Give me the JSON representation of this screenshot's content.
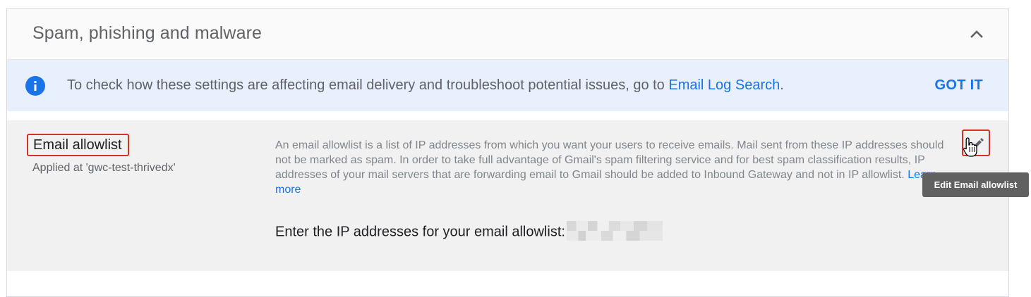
{
  "section": {
    "title": "Spam, phishing and malware",
    "collapse_icon": "chevron-up-icon"
  },
  "banner": {
    "icon": "info-icon",
    "text": "To check how these settings are affecting email delivery and troubleshoot potential issues, go to ",
    "link": "Email Log Search",
    "text_end": ".",
    "action": "GOT IT"
  },
  "setting": {
    "name": "Email allowlist",
    "applied_at": "Applied at 'gwc-test-thrivedx'",
    "description": "An email allowlist is a list of IP addresses from which you want your users to receive emails. Mail sent from these IP addresses should not be marked as spam. In order to take full advantage of Gmail's spam filtering service and for best spam classification results, IP addresses of your mail servers that are forwarding email to Gmail should be added to Inbound Gateway and not in IP allowlist. ",
    "learn_more": "Learn more",
    "ip_label": "Enter the IP addresses for your email allowlist:",
    "edit_icon": "pencil-icon",
    "tooltip": "Edit Email allowlist"
  },
  "colors": {
    "accent": "#1a73e8",
    "highlight_border": "#d93025",
    "banner_bg": "#e8f0fe",
    "row_bg": "#f1f1f1",
    "tooltip_bg": "#616161"
  }
}
